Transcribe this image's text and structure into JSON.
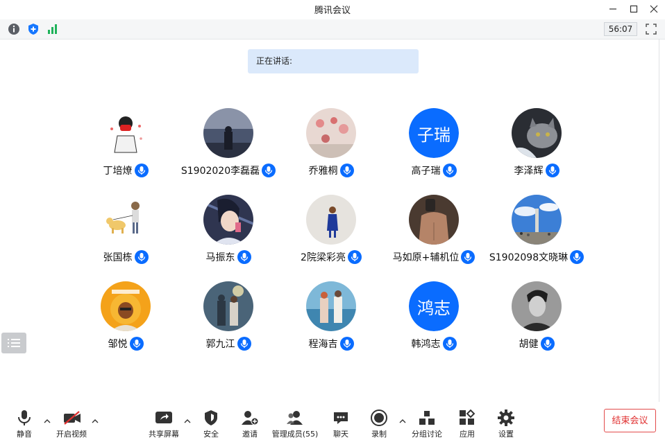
{
  "window": {
    "title": "腾讯会议"
  },
  "status": {
    "timer": "56:07",
    "info_icon": "info-icon",
    "security_icon": "shield-plus-icon",
    "signal_icon": "signal-bars-icon"
  },
  "speaking": {
    "label": "正在讲话:"
  },
  "participants": [
    {
      "name": "丁培燎",
      "avatar": "cartoon-masked-person"
    },
    {
      "name": "S1902020李磊磊",
      "avatar": "person-by-sea-photo"
    },
    {
      "name": "乔雅桐",
      "avatar": "pink-flowers-photo"
    },
    {
      "name": "高子瑞",
      "avatar_text": "子瑞"
    },
    {
      "name": "李泽辉",
      "avatar": "cat-photo"
    },
    {
      "name": "张国栋",
      "avatar": "cartoon-dog-walk"
    },
    {
      "name": "马振东",
      "avatar": "anime-boy"
    },
    {
      "name": "2院梁彩亮",
      "avatar": "person-in-blue-dress"
    },
    {
      "name": "马如原+辅机位",
      "avatar": "mirror-selfie-photo"
    },
    {
      "name": "S1902098文晓琳",
      "avatar": "monument-sky-photo"
    },
    {
      "name": "邹悦",
      "avatar": "sunny-orange-cartoon"
    },
    {
      "name": "郭九江",
      "avatar": "couple-fireworks-photo"
    },
    {
      "name": "程海吉",
      "avatar": "couple-beach-photo"
    },
    {
      "name": "韩鸿志",
      "avatar_text": "鸿志"
    },
    {
      "name": "胡健",
      "avatar": "black-white-portrait"
    }
  ],
  "toolbar": {
    "mute": "静音",
    "video": "开启视频",
    "share": "共享屏幕",
    "security": "安全",
    "invite": "邀请",
    "members": "管理成员(55)",
    "chat": "聊天",
    "record": "录制",
    "breakout": "分组讨论",
    "apps": "应用",
    "settings": "设置",
    "end": "结束会议"
  },
  "colors": {
    "accent": "#0a6cff",
    "speaking_bg": "#dbe9fb",
    "end_red": "#e02f2f"
  }
}
